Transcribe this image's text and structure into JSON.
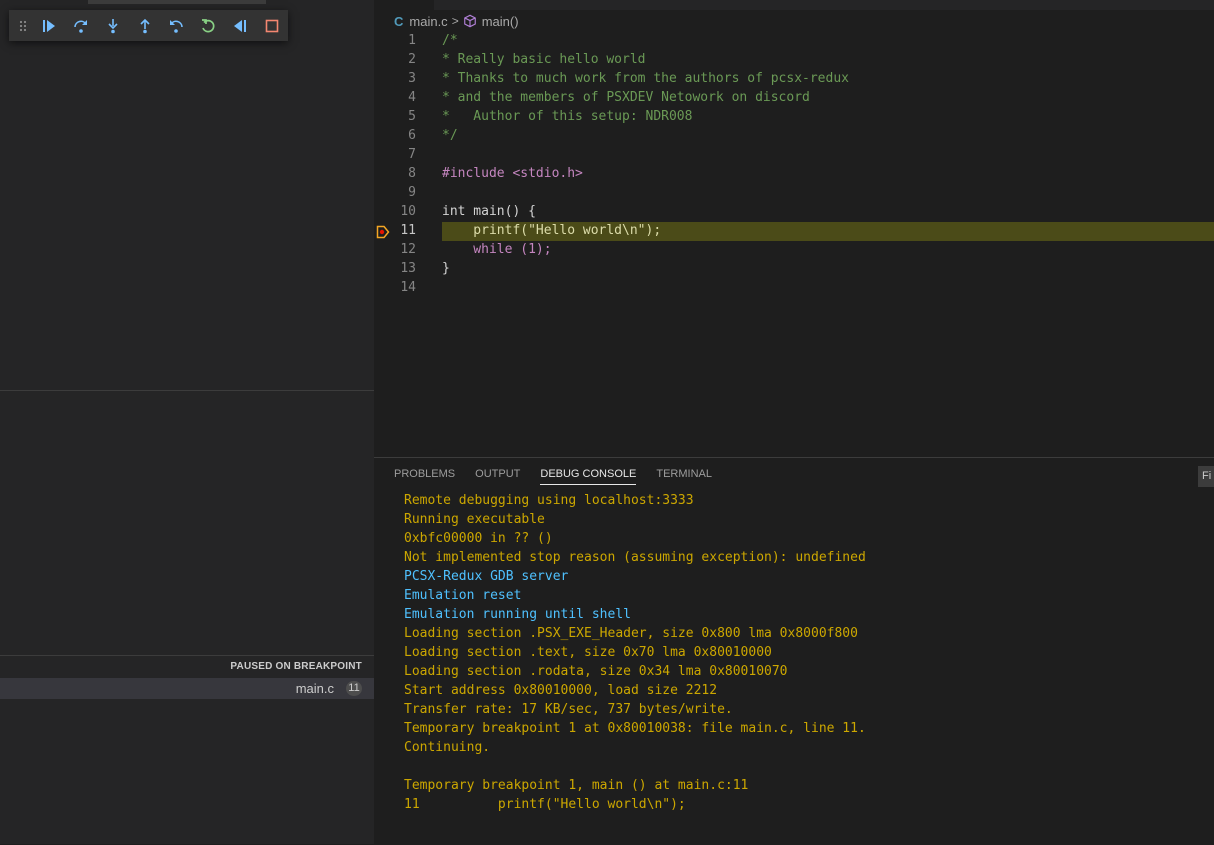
{
  "debug_toolbar": {
    "buttons": [
      "drag-grip-icon",
      "continue-icon",
      "step-over-icon",
      "step-into-icon",
      "step-out-icon",
      "step-back-icon",
      "restart-icon",
      "reverse-continue-icon",
      "stop-icon"
    ]
  },
  "editor": {
    "breadcrumb": {
      "file_icon": "C",
      "file": "main.c",
      "separator": ">",
      "symbol": "main()"
    },
    "current_line": 11,
    "lines": [
      {
        "n": "1",
        "text": "/*"
      },
      {
        "n": "2",
        "text": "* Really basic hello world"
      },
      {
        "n": "3",
        "text": "* Thanks to much work from the authors of pcsx-redux"
      },
      {
        "n": "4",
        "text": "* and the members of PSXDEV Netowork on discord"
      },
      {
        "n": "5",
        "text": "*   Author of this setup: NDR008"
      },
      {
        "n": "6",
        "text": "*/"
      },
      {
        "n": "7",
        "text": ""
      },
      {
        "n": "8",
        "text": "#include <stdio.h>"
      },
      {
        "n": "9",
        "text": ""
      },
      {
        "n": "10",
        "text": "int main() {"
      },
      {
        "n": "11",
        "text": "    printf(\"Hello world\\n\");"
      },
      {
        "n": "12",
        "text": "    while (1);"
      },
      {
        "n": "13",
        "text": "}"
      },
      {
        "n": "14",
        "text": ""
      }
    ]
  },
  "call_stack": {
    "header": "PAUSED ON BREAKPOINT",
    "frames": [
      {
        "file": "main.c",
        "line": "11"
      }
    ]
  },
  "panel": {
    "tabs": [
      "PROBLEMS",
      "OUTPUT",
      "DEBUG CONSOLE",
      "TERMINAL"
    ],
    "active_tab": "DEBUG CONSOLE",
    "filter_label": "Fi",
    "console": [
      {
        "text": "Remote debugging using localhost:3333",
        "color": "yellow"
      },
      {
        "text": "Running executable",
        "color": "yellow"
      },
      {
        "text": "0xbfc00000 in ?? ()",
        "color": "yellow"
      },
      {
        "text": "Not implemented stop reason (assuming exception): undefined",
        "color": "yellow"
      },
      {
        "text": "PCSX-Redux GDB server",
        "color": "blue"
      },
      {
        "text": "Emulation reset",
        "color": "blue"
      },
      {
        "text": "Emulation running until shell",
        "color": "blue"
      },
      {
        "text": "Loading section .PSX_EXE_Header, size 0x800 lma 0x8000f800",
        "color": "yellow"
      },
      {
        "text": "Loading section .text, size 0x70 lma 0x80010000",
        "color": "yellow"
      },
      {
        "text": "Loading section .rodata, size 0x34 lma 0x80010070",
        "color": "yellow"
      },
      {
        "text": "Start address 0x80010000, load size 2212",
        "color": "yellow"
      },
      {
        "text": "Transfer rate: 17 KB/sec, 737 bytes/write.",
        "color": "yellow"
      },
      {
        "text": "Temporary breakpoint 1 at 0x80010038: file main.c, line 11.",
        "color": "yellow"
      },
      {
        "text": "Continuing.",
        "color": "yellow"
      },
      {
        "text": "",
        "color": "yellow"
      },
      {
        "text": "Temporary breakpoint 1, main () at main.c:11",
        "color": "yellow"
      },
      {
        "text": "11          printf(\"Hello world\\n\");",
        "color": "yellow"
      }
    ]
  },
  "colors": {
    "console_yellow": "#cca700",
    "console_blue": "#4fc1ff",
    "current_line_bg": "#4b4b18",
    "breakpoint": "#f5a623"
  }
}
